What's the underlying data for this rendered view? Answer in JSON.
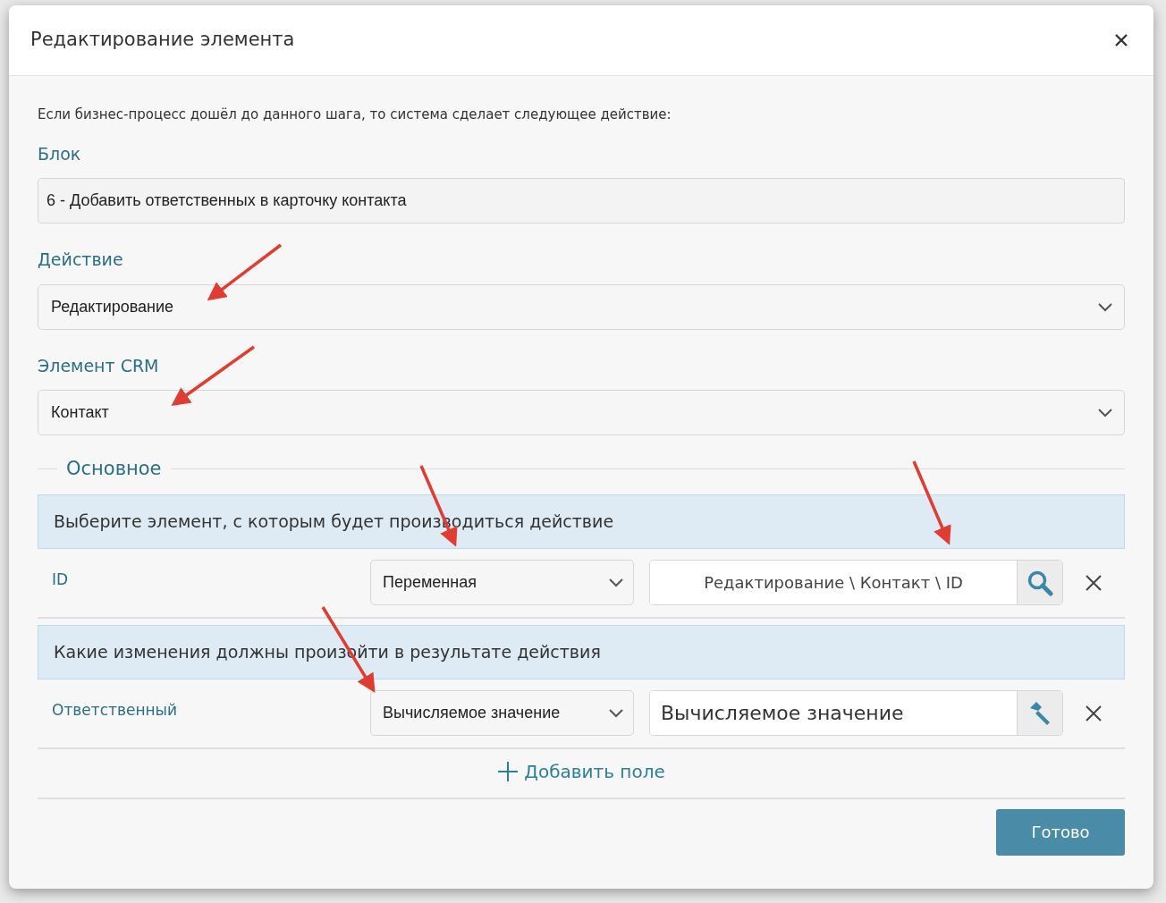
{
  "dialog": {
    "title": "Редактирование элемента"
  },
  "intro": "Если бизнес-процесс дошёл до данного шага, то система сделает следующее действие:",
  "fields": [
    {
      "label": "Блок",
      "kind": "text",
      "value": "6 - Добавить ответственных в карточку контакта"
    },
    {
      "label": "Действие",
      "kind": "select",
      "value": "Редактирование"
    },
    {
      "label": "Элемент CRM",
      "kind": "select",
      "value": "Контакт"
    }
  ],
  "section": {
    "legend": "Основное",
    "groups": [
      {
        "heading": "Выберите элемент, с которым будет производиться действие",
        "rows": [
          {
            "label": "ID",
            "source": "Переменная",
            "value": "Редактирование \\ Контакт \\ ID",
            "kind": "variable"
          }
        ]
      },
      {
        "heading": "Какие изменения должны произойти в результате действия",
        "rows": [
          {
            "label": "Ответственный",
            "source": "Вычисляемое значение",
            "value": "Вычисляемое значение",
            "kind": "expression"
          }
        ]
      }
    ]
  },
  "add_field": "Добавить поле",
  "done_button": "Готово"
}
